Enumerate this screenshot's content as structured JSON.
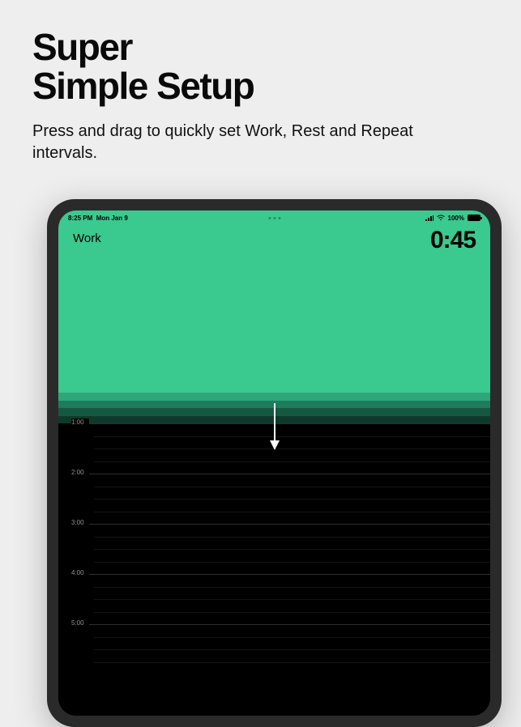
{
  "header": {
    "title_line1": "Super",
    "title_line2": "Simple Setup",
    "subtitle": "Press and drag to quickly set Work, Rest and Repeat intervals."
  },
  "status_bar": {
    "time": "8:25 PM",
    "date": "Mon Jan 9",
    "battery_pct": "100%"
  },
  "work": {
    "label": "Work",
    "time": "0:45",
    "fill_color": "#3ac98f"
  },
  "transition_bands": [
    "#2ea67a",
    "#1f7b5c",
    "#155942",
    "#0d3a2c"
  ],
  "timeline": {
    "minutes": [
      "1:00",
      "2:00",
      "3:00",
      "4:00",
      "5:00"
    ]
  }
}
